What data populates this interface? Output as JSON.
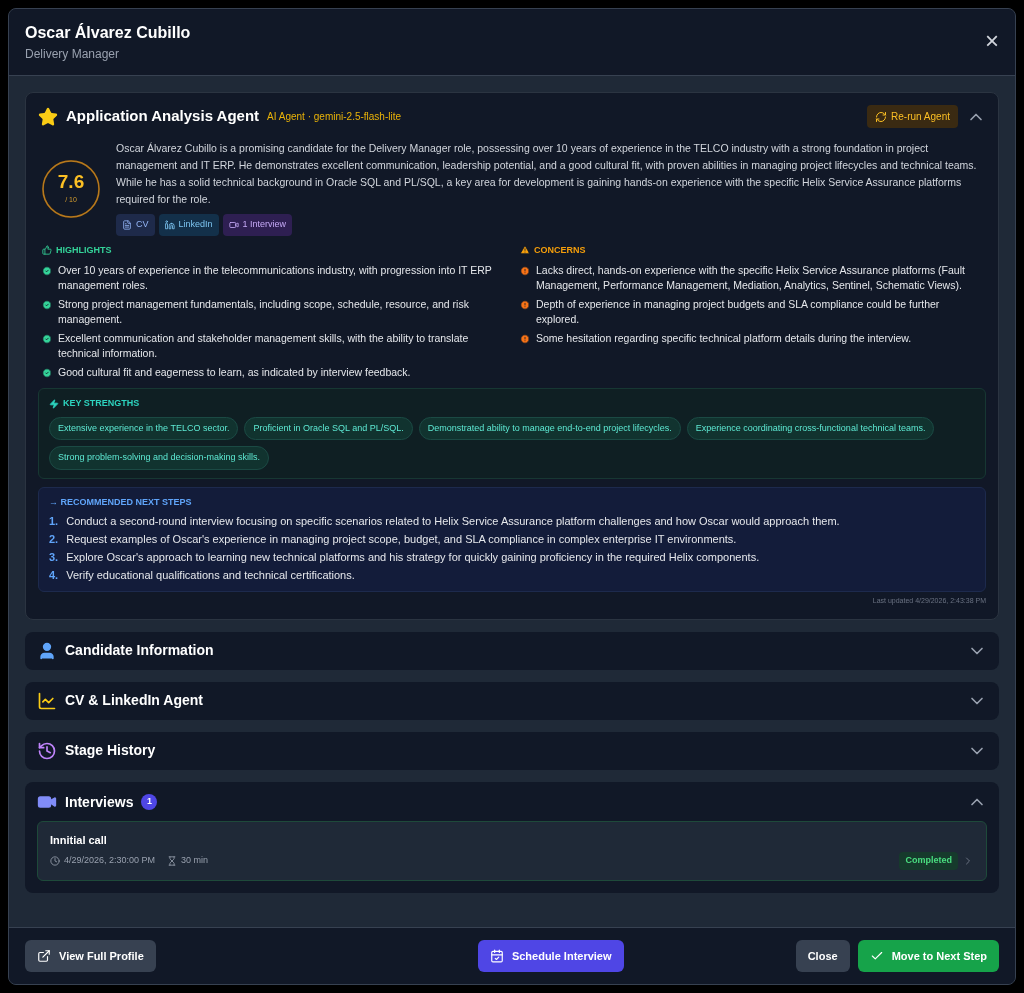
{
  "header": {
    "name": "Oscar Álvarez Cubillo",
    "role": "Delivery Manager",
    "close": "×"
  },
  "analysis": {
    "title": "Application Analysis Agent",
    "agent_label": "AI Agent · gemini-2.5-flash-lite",
    "rerun": "Re-run Agent",
    "expanded": true,
    "score": "7.6",
    "score_max": "/ 10",
    "summary": "Oscar Álvarez Cubillo is a promising candidate for the Delivery Manager role, possessing over 10 years of experience in the TELCO industry with a strong foundation in project management and IT ERP. He demonstrates excellent communication, leadership potential, and a good cultural fit, with proven abilities in managing project lifecycles and technical teams. While he has a solid technical background in Oracle SQL and PL/SQL, a key area for development is gaining hands-on experience with the specific Helix Service Assurance platforms required for the role.",
    "sources": [
      {
        "kind": "cv",
        "label": "CV"
      },
      {
        "kind": "linkedin",
        "label": "LinkedIn"
      },
      {
        "kind": "interview",
        "label": "1 Interview"
      }
    ],
    "highlights_title": "HIGHLIGHTS",
    "highlights": [
      "Over 10 years of experience in the telecommunications industry, with progression into IT ERP management roles.",
      "Strong project management fundamentals, including scope, schedule, resource, and risk management.",
      "Excellent communication and stakeholder management skills, with the ability to translate technical information.",
      "Good cultural fit and eagerness to learn, as indicated by interview feedback."
    ],
    "concerns_title": "CONCERNS",
    "concerns": [
      "Lacks direct, hands-on experience with the specific Helix Service Assurance platforms (Fault Management, Performance Management, Mediation, Analytics, Sentinel, Schematic Views).",
      "Depth of experience in managing project budgets and SLA compliance could be further explored.",
      "Some hesitation regarding specific technical platform details during the interview."
    ],
    "strengths_title": "KEY STRENGTHS",
    "strengths": [
      "Extensive experience in the TELCO sector.",
      "Proficient in Oracle SQL and PL/SQL.",
      "Demonstrated ability to manage end-to-end project lifecycles.",
      "Experience coordinating cross-functional technical teams.",
      "Strong problem-solving and decision-making skills."
    ],
    "next_title": "→ RECOMMENDED NEXT STEPS",
    "next_steps": [
      {
        "num": "1.",
        "text": "Conduct a second-round interview focusing on specific scenarios related to Helix Service Assurance platform challenges and how Oscar would approach them."
      },
      {
        "num": "2.",
        "text": "Request examples of Oscar's experience in managing project scope, budget, and SLA compliance in complex enterprise IT environments."
      },
      {
        "num": "3.",
        "text": "Explore Oscar's approach to learning new technical platforms and his strategy for quickly gaining proficiency in the required Helix components."
      },
      {
        "num": "4.",
        "text": "Verify educational qualifications and technical certifications."
      }
    ],
    "last_updated": "Last updated 4/29/2026, 2:43:38 PM"
  },
  "sections": [
    {
      "kind": "person",
      "title": "Candidate Information",
      "expanded": false
    },
    {
      "kind": "chart",
      "title": "CV & LinkedIn Agent",
      "expanded": false
    },
    {
      "kind": "history",
      "title": "Stage History",
      "expanded": false
    }
  ],
  "interviews": {
    "title": "Interviews",
    "count": "1",
    "expanded": true,
    "items": [
      {
        "title": "Innitial call",
        "date": "4/29/2026, 2:30:00 PM",
        "duration": "30 min",
        "status": "Completed"
      }
    ]
  },
  "footer": {
    "view_profile": "View Full Profile",
    "schedule": "Schedule Interview",
    "close": "Close",
    "next": "Move to Next Step"
  }
}
